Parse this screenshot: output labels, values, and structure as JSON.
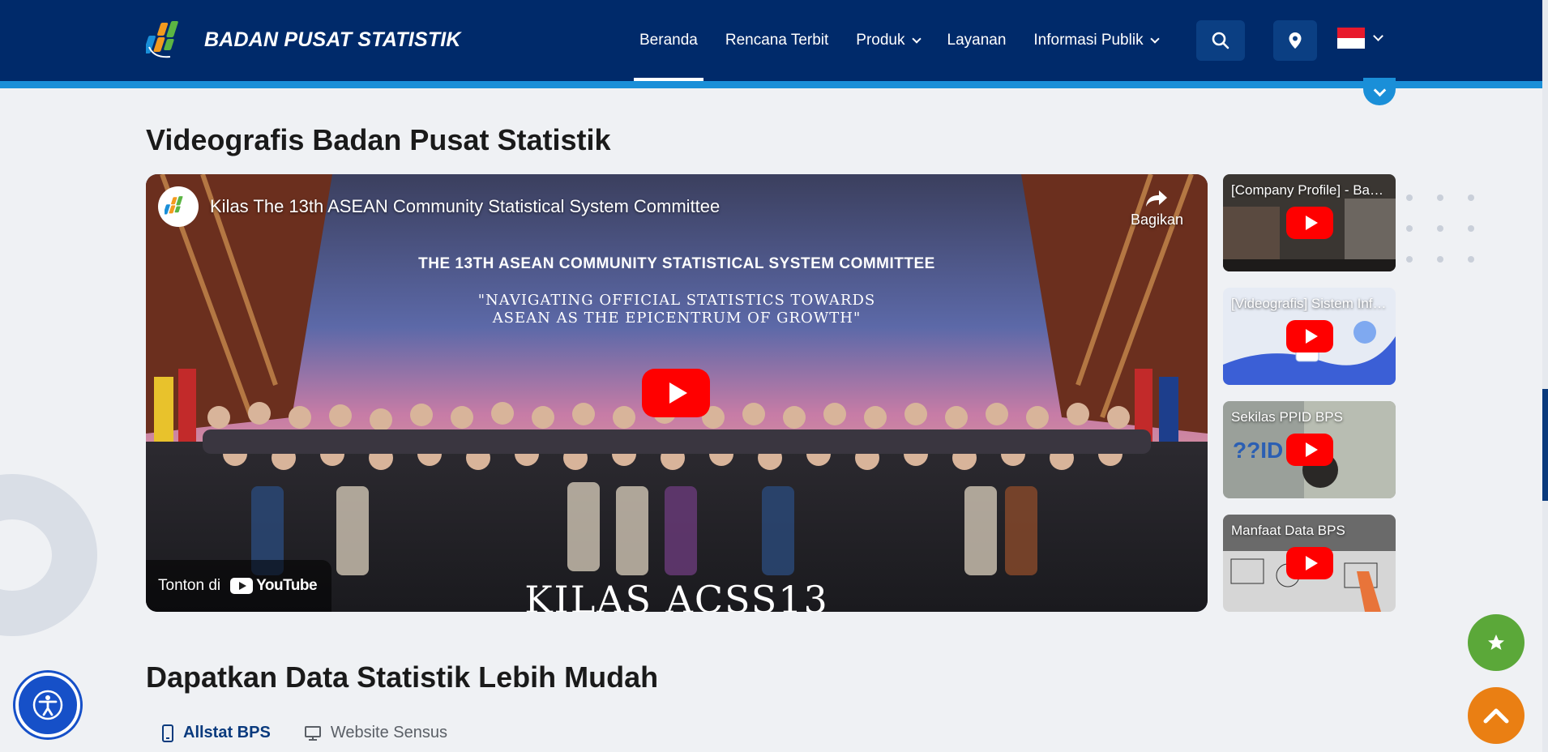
{
  "header": {
    "brand_name": "BADAN PUSAT STATISTIK",
    "nav": [
      {
        "label": "Beranda",
        "active": true,
        "has_dropdown": false
      },
      {
        "label": "Rencana Terbit",
        "active": false,
        "has_dropdown": false
      },
      {
        "label": "Produk",
        "active": false,
        "has_dropdown": true
      },
      {
        "label": "Layanan",
        "active": false,
        "has_dropdown": false
      },
      {
        "label": "Informasi Publik",
        "active": false,
        "has_dropdown": true
      }
    ],
    "icons": {
      "search": "search-icon",
      "location": "map-pin-icon",
      "language": "indonesia-flag-icon"
    },
    "colors": {
      "background": "#002a6a",
      "stripe": "#1a8fd8"
    }
  },
  "videografis": {
    "title": "Videografis Badan Pusat Statistik",
    "main_video": {
      "title": "Kilas The 13th ASEAN Community Statistical System Committee",
      "share_label": "Bagikan",
      "watch_on_label": "Tonton di",
      "youtube_label": "YouTube",
      "stage_heading": "THE 13TH ASEAN COMMUNITY STATISTICAL SYSTEM COMMITTEE",
      "stage_subtitle_1": "\"NAVIGATING OFFICIAL STATISTICS TOWARDS",
      "stage_subtitle_2": "ASEAN AS THE EPICENTRUM OF GROWTH\"",
      "stage_bottom": "KILAS ACSS13"
    },
    "playlist": [
      {
        "title": "[Company Profile] - Badan Pusat Statistik"
      },
      {
        "title": "[Videografis] Sistem Informasi Statistik"
      },
      {
        "title": "Sekilas PPID BPS"
      },
      {
        "title": "Manfaat Data BPS"
      }
    ]
  },
  "data_section": {
    "title": "Dapatkan Data Statistik Lebih Mudah",
    "tabs": [
      {
        "label": "Allstat BPS",
        "icon": "smartphone-icon",
        "active": true
      },
      {
        "label": "Website Sensus",
        "icon": "monitor-icon",
        "active": false
      }
    ]
  },
  "floating": {
    "accessibility_icon": "accessibility-icon",
    "favorite_icon": "star-icon",
    "scroll_top_icon": "chevron-up-icon",
    "colors": {
      "accessibility": "#1650c8",
      "favorite": "#5ba839",
      "scroll_top": "#ea7f13"
    }
  }
}
